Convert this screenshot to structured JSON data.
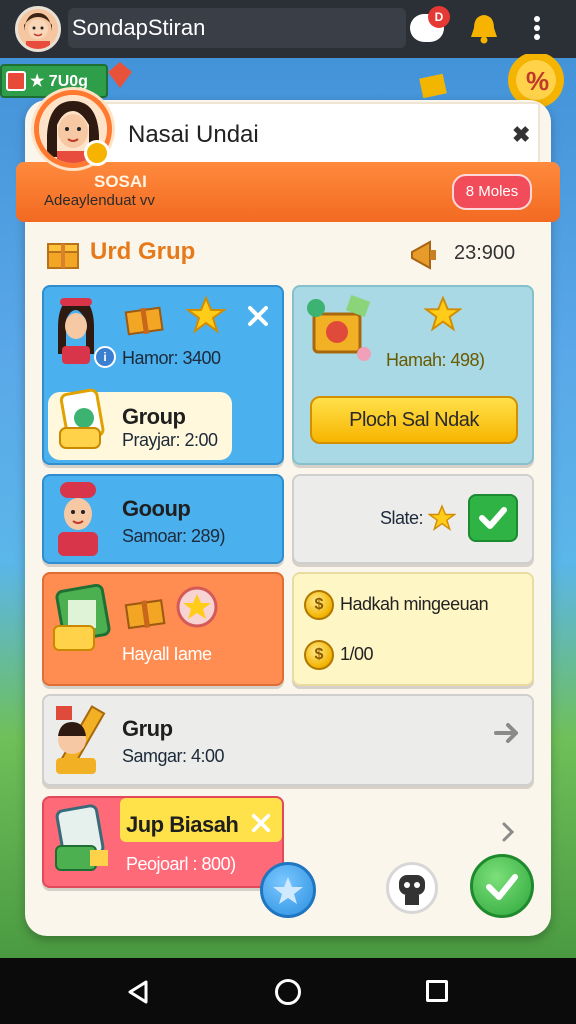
{
  "topbar": {
    "title": "SondapStiran",
    "notification_badge": "D"
  },
  "score_chip": {
    "value": "★ 7U0g"
  },
  "profile": {
    "name": "Nasai Undai",
    "close_label": "✖",
    "band_title": "SOSAI",
    "band_subtitle": "Adeaylenduat vv",
    "band_button": "8 Moles"
  },
  "section": {
    "title": "Urd Grup",
    "points": "23:900"
  },
  "tiles": {
    "t1": {
      "stat": "Hamor: 3400",
      "card_title": "Group",
      "card_sub": "Prayjar: 2:00"
    },
    "t2": {
      "stat": "Hamah: 498)",
      "button": "Ploch Sal Ndak"
    },
    "t3": {
      "title": "Gooup",
      "sub": "Samoar: 289)"
    },
    "t4": {
      "label": "Slate:"
    },
    "t5": {
      "label": "Hayall Iame"
    },
    "t6": {
      "title": "Hadkah mingeeuan",
      "value": "1/00"
    },
    "t7": {
      "title": "Grup",
      "sub": "Samgar: 4:00"
    },
    "t8": {
      "title": "Jup Biasah",
      "sub": "Peojoarl : 800)"
    }
  },
  "colors": {
    "accent_orange": "#f26a22",
    "tile_blue": "#4ab0ee",
    "button_yellow": "#f7b500",
    "check_green": "#2fb344"
  },
  "icons": [
    "avatar",
    "chat-bubble-icon",
    "bell-icon",
    "more-vert-icon",
    "star-icon",
    "close-icon",
    "gift-box-icon",
    "coin-icon",
    "check-icon",
    "arrow-right-icon",
    "robot-icon",
    "back-icon",
    "home-icon",
    "recents-icon"
  ]
}
